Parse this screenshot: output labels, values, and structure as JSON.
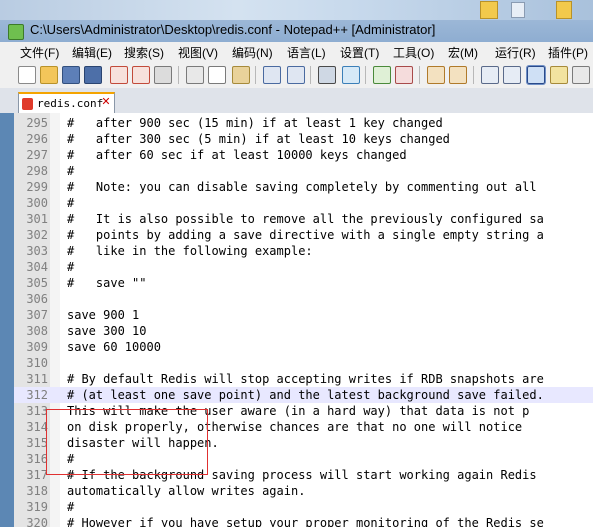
{
  "window": {
    "title": "C:\\Users\\Administrator\\Desktop\\redis.conf - Notepad++ [Administrator]"
  },
  "menu": [
    "文件(F)",
    "编辑(E)",
    "搜索(S)",
    "视图(V)",
    "编码(N)",
    "语言(L)",
    "设置(T)",
    "工具(O)",
    "宏(M)",
    "运行(R)",
    "插件(P)"
  ],
  "toolbar_icons": [
    "new-file-icon",
    "open-file-icon",
    "save-icon",
    "save-all-icon",
    "close-file-icon",
    "close-all-icon",
    "print-icon",
    "cut-icon",
    "copy-icon",
    "paste-icon",
    "undo-icon",
    "redo-icon",
    "find-icon",
    "replace-icon",
    "zoom-in-icon",
    "zoom-out-icon",
    "sync-vertical-icon",
    "sync-horizontal-icon",
    "word-wrap-icon",
    "show-all-chars-icon",
    "indent-guide-icon",
    "document-map-icon"
  ],
  "tab": {
    "label": "redis.conf"
  },
  "editor": {
    "lines": [
      {
        "n": "295",
        "text": "#   after 900 sec (15 min) if at least 1 key changed"
      },
      {
        "n": "296",
        "text": "#   after 300 sec (5 min) if at least 10 keys changed"
      },
      {
        "n": "297",
        "text": "#   after 60 sec if at least 10000 keys changed"
      },
      {
        "n": "298",
        "text": "#"
      },
      {
        "n": "299",
        "text": "#   Note: you can disable saving completely by commenting out all"
      },
      {
        "n": "300",
        "text": "#"
      },
      {
        "n": "301",
        "text": "#   It is also possible to remove all the previously configured sa"
      },
      {
        "n": "302",
        "text": "#   points by adding a save directive with a single empty string a"
      },
      {
        "n": "303",
        "text": "#   like in the following example:"
      },
      {
        "n": "304",
        "text": "#"
      },
      {
        "n": "305",
        "text": "#   save \"\""
      },
      {
        "n": "306",
        "text": ""
      },
      {
        "n": "307",
        "text": "save 900 1"
      },
      {
        "n": "308",
        "text": "save 300 10"
      },
      {
        "n": "309",
        "text": "save 60 10000"
      },
      {
        "n": "310",
        "text": ""
      },
      {
        "n": "311",
        "text": "# By default Redis will stop accepting writes if RDB snapshots are"
      },
      {
        "n": "312",
        "text": "# (at least one save point) and the latest background save failed."
      },
      {
        "n": "313",
        "text": "This will make the user aware (in a hard way) that data is not p"
      },
      {
        "n": "314",
        "text": "on disk properly, otherwise chances are that no one will notice"
      },
      {
        "n": "315",
        "text": "disaster will happen."
      },
      {
        "n": "316",
        "text": "#"
      },
      {
        "n": "317",
        "text": "# If the background saving process will start working again Redis"
      },
      {
        "n": "318",
        "text": "automatically allow writes again."
      },
      {
        "n": "319",
        "text": "#"
      },
      {
        "n": "320",
        "text": "# However if you have setup your proper monitoring of the Redis se"
      }
    ]
  }
}
